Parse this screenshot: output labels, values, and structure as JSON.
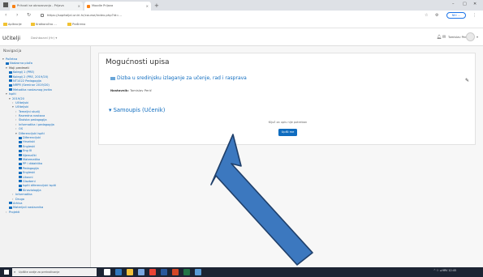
{
  "browser": {
    "tabs": [
      {
        "label": "Prihvati se obrazovanja - Prijava"
      },
      {
        "label": "Moodle Prijava"
      }
    ],
    "new_tab_glyph": "+",
    "close_glyph": "×",
    "window_controls": {
      "minimize": "–",
      "maximize": "□",
      "close": "✕"
    },
    "url": "https://sopitaljal.uniri.hr/course/index.php?id=…",
    "profile_label": "Niti …",
    "bookmarks": [
      {
        "label": "Aplikacije"
      },
      {
        "label": "Kratkoročno …"
      },
      {
        "label": "Prošireno"
      }
    ]
  },
  "moodle": {
    "brand": "Učitelji",
    "language": "Dashboard (Hr) ▾",
    "username": "Tomislav Perić",
    "avatar_caret": "▾"
  },
  "drawer": {
    "title": "Navigacija",
    "tree": [
      {
        "label": "Početna",
        "level": 0,
        "icon": false,
        "twisty": "▾",
        "dark": false
      },
      {
        "label": "Nadzorna ploča",
        "level": 1,
        "icon": true,
        "dark": false
      },
      {
        "label": "Moji predmeti",
        "level": 1,
        "twisty": "▾",
        "icon": false,
        "dark": true
      },
      {
        "label": "Kolegij 1 (PRE)",
        "level": 2,
        "icon": true,
        "dark": false
      },
      {
        "label": "Kolegij 2 (PRE, 2019/20)",
        "level": 2,
        "icon": true,
        "dark": false
      },
      {
        "label": "NT1022 Pedagogija",
        "level": 2,
        "icon": true,
        "dark": false
      },
      {
        "label": "NRPR (Seminar 2019/20)",
        "level": 2,
        "icon": true,
        "dark": false
      },
      {
        "label": "Metodika nastavnog jezika",
        "level": 2,
        "icon": true,
        "dark": false
      },
      {
        "label": "Ispiti",
        "level": 1,
        "twisty": "▾",
        "icon": false,
        "dark": false
      },
      {
        "label": "2019/20",
        "level": 2,
        "twisty": "▾",
        "icon": false,
        "dark": false
      },
      {
        "label": "Učiteljski",
        "level": 3,
        "twisty": "›",
        "icon": false,
        "dark": false
      },
      {
        "label": "Učiteljski",
        "level": 3,
        "twisty": "▾",
        "icon": false,
        "dark": false
      },
      {
        "label": "Temeljni studij",
        "level": 4,
        "twisty": "›",
        "icon": false,
        "dark": false
      },
      {
        "label": "Razredna nastava",
        "level": 4,
        "twisty": "›",
        "icon": false,
        "dark": false
      },
      {
        "label": "Školska pedagogija",
        "level": 4,
        "twisty": "›",
        "icon": false,
        "dark": false
      },
      {
        "label": "Informatika i pedagogija",
        "level": 4,
        "twisty": "›",
        "icon": false,
        "dark": false
      },
      {
        "label": "OS",
        "level": 4,
        "twisty": "›",
        "icon": false,
        "dark": false
      },
      {
        "label": "Diferencijski ispiti",
        "level": 4,
        "twisty": "▾",
        "icon": false,
        "dark": false
      },
      {
        "label": "Diferencijski",
        "level": 5,
        "icon": true,
        "dark": false
      },
      {
        "label": "Hrvatski",
        "level": 5,
        "icon": true,
        "dark": false
      },
      {
        "label": "Engleski",
        "level": 5,
        "icon": true,
        "dark": false
      },
      {
        "label": "Eng III",
        "level": 5,
        "icon": true,
        "dark": false
      },
      {
        "label": "Njemački",
        "level": 5,
        "icon": true,
        "dark": false
      },
      {
        "label": "Matematika",
        "level": 5,
        "icon": true,
        "dark": false
      },
      {
        "label": "PP i didaktika",
        "level": 5,
        "icon": true,
        "dark": false
      },
      {
        "label": "Pedagogija",
        "level": 5,
        "icon": true,
        "dark": false
      },
      {
        "label": "Engleski",
        "level": 5,
        "icon": true,
        "dark": false
      },
      {
        "label": "Likovni",
        "level": 5,
        "icon": true,
        "dark": false
      },
      {
        "label": "Glazbeni",
        "level": 5,
        "icon": true,
        "dark": false
      },
      {
        "label": "Ispiti diferencijski ispiti",
        "level": 5,
        "icon": true,
        "dark": false
      },
      {
        "label": "Kineziologija",
        "level": 5,
        "icon": true,
        "dark": false
      },
      {
        "label": "Informatika",
        "level": 3,
        "twisty": "›",
        "icon": false,
        "dark": false
      },
      {
        "label": "Drugo",
        "level": 3,
        "twisty": "›",
        "icon": false,
        "dark": false
      },
      {
        "label": "Arhiva",
        "level": 2,
        "icon": true,
        "dark": false
      },
      {
        "label": "Materijali nastavnika",
        "level": 2,
        "icon": true,
        "dark": false
      },
      {
        "label": "Projekti",
        "level": 1,
        "twisty": "›",
        "icon": false,
        "dark": false
      }
    ]
  },
  "page": {
    "title": "Mogućnosti upisa",
    "course_name": "Dizba u sredinjsku izlaganje za učenje, rad i rasprava",
    "teacher_label": "Nastavnik:",
    "teacher_name": "Tomislav Perić",
    "card_icon": "✎",
    "enrol_method": "Samoupis (Učenik)",
    "enrol_note": "Ključ za upis nije potreban",
    "enrol_button": "Upiši me"
  },
  "taskbar": {
    "search_placeholder": "Upišite ovdje za pretraživanje",
    "search_glyph": "⌕",
    "tray_text": "^ ⚐ ◂ HRV 12:45",
    "apps": [
      {
        "icon": "task-view-icon",
        "color": "#ffffff"
      },
      {
        "icon": "edge-icon",
        "color": "#3277bc"
      },
      {
        "icon": "file-explorer-icon",
        "color": "#f3c13a"
      },
      {
        "icon": "store-icon",
        "color": "#7ba7e0"
      },
      {
        "icon": "chrome-icon",
        "color": "#e94335"
      },
      {
        "icon": "word-icon",
        "color": "#2b579a"
      },
      {
        "icon": "powerpoint-icon",
        "color": "#d24726"
      },
      {
        "icon": "excel-icon",
        "color": "#217346"
      },
      {
        "icon": "app-icon",
        "color": "#5a9bd5"
      }
    ]
  },
  "colors": {
    "moodle_link": "#0f6cbf",
    "arrow_fill": "#3c78bf",
    "arrow_stroke": "#1f3f6a"
  }
}
